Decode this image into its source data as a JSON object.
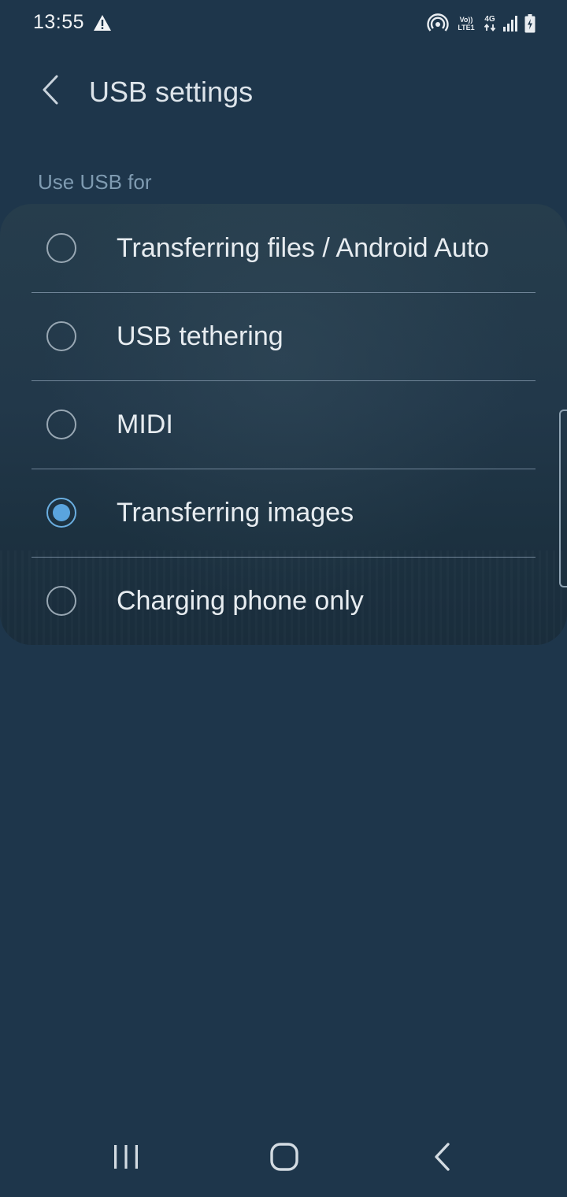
{
  "status_bar": {
    "time": "13:55",
    "network_top": "Vo)) LTE1",
    "network_type": "4G",
    "icons": [
      "alert-icon",
      "hotspot-icon",
      "volte-icon",
      "4g-data-icon",
      "signal-icon",
      "battery-charging-icon"
    ]
  },
  "header": {
    "title": "USB settings",
    "back_icon": "chevron-left-icon"
  },
  "section": {
    "title": "Use USB for"
  },
  "options": [
    {
      "label": "Transferring files / Android Auto",
      "selected": false
    },
    {
      "label": "USB tethering",
      "selected": false
    },
    {
      "label": "MIDI",
      "selected": false
    },
    {
      "label": "Transferring images",
      "selected": true
    },
    {
      "label": "Charging phone only",
      "selected": false
    }
  ],
  "nav_bar": {
    "recents_icon": "recents-icon",
    "home_icon": "home-icon",
    "back_icon": "back-icon"
  },
  "colors": {
    "background": "#1e364b",
    "accent": "#5aa4de",
    "text": "#e7ecf0",
    "section_header": "#7f9bb1"
  }
}
